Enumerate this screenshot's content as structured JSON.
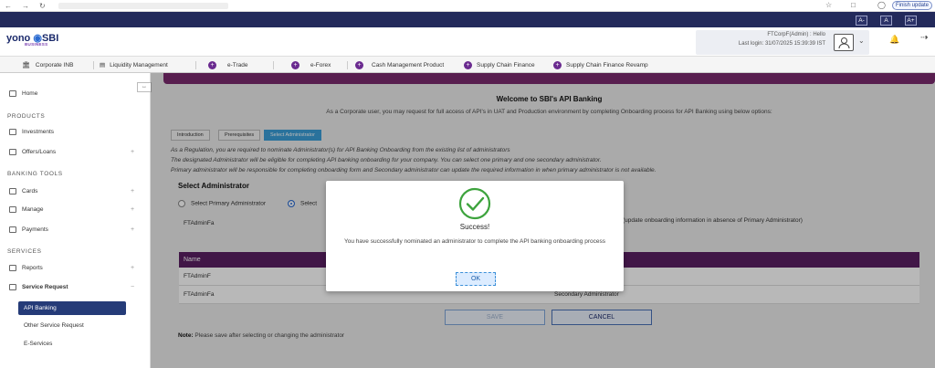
{
  "browser": {
    "finish_update": "Finish update"
  },
  "font_controls": [
    "A-",
    "A",
    "A+"
  ],
  "header": {
    "logo_yono": "yono",
    "logo_sbi": "SBI",
    "logo_sub": "BUSINESS",
    "user_line": "FTCorpF(Admin) : Hello",
    "last_login": "Last login: 31/07/2025 15:39:39 IST"
  },
  "nav": [
    {
      "label": "Corporate INB"
    },
    {
      "label": "Liquidity Management"
    },
    {
      "label": "e-Trade"
    },
    {
      "label": "e-Forex"
    },
    {
      "label": "Cash Management Product"
    },
    {
      "label": "Supply Chain Finance"
    },
    {
      "label": "Supply Chain Finance Revamp"
    }
  ],
  "sidebar": {
    "home": "Home",
    "products_head": "PRODUCTS",
    "investments": "Investments",
    "offers": "Offers/Loans",
    "banking_head": "BANKING TOOLS",
    "cards": "Cards",
    "manage": "Manage",
    "payments": "Payments",
    "services_head": "SERVICES",
    "reports": "Reports",
    "service_request": "Service Request",
    "api_banking": "API Banking",
    "other_service": "Other Service Request",
    "eservices": "E-Services"
  },
  "main": {
    "welcome": "Welcome to SBI's API Banking",
    "intro": "As a Corporate user, you may request for full access of API's in UAT and Production environment by completing Onboarding process for API Banking using below options:",
    "tabs": [
      "Introduction",
      "Prerequisites",
      "Select Administrator"
    ],
    "notes": [
      "As a Regulation, you are required to nominate Administrator(s) for API Banking Onboarding from the existing list of administrators",
      "The designated Administrator will be eligible for completing API banking onboarding for your company. You can select one primary and one secondary administrator.",
      "Primary administrator will be responsible for completing onboarding form and Secondary administrator can update the required information in when primary administrator is not available."
    ],
    "select_title": "Select Administrator",
    "radio_primary": "Select Primary Administrator",
    "radio_secondary": "Select",
    "admin_value": "FTAdminFa",
    "secondary_note": "(update onboarding information in absence of Primary Administrator)",
    "table_header": "Name",
    "rows": [
      {
        "name": "FTAdminF",
        "role": ""
      },
      {
        "name": "FTAdminFa",
        "role": "Secondary Administrator"
      }
    ],
    "save": "SAVE",
    "cancel": "CANCEL",
    "footnote_label": "Note:",
    "footnote_text": "Please save after selecting or changing the administrator"
  },
  "modal": {
    "title": "Success!",
    "message": "You have successfully nominated an administrator to complete the API banking onboarding process",
    "ok": "OK"
  }
}
